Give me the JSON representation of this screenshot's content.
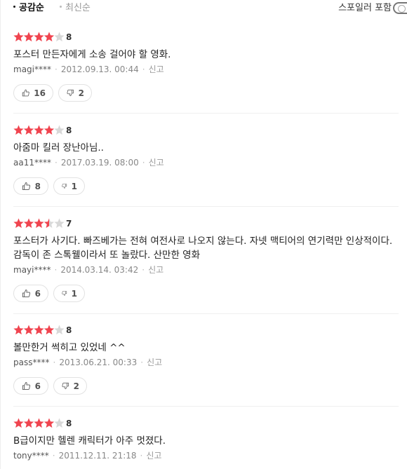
{
  "sort": {
    "option_sympathy": "공감순",
    "option_latest": "최신순",
    "spoiler_label": "스포일러 포함"
  },
  "colors": {
    "star_on": "#f0444f",
    "star_off": "#d8d8d8",
    "accent_text": "#111111"
  },
  "reviews": [
    {
      "stars": 4,
      "score": "8",
      "content": "포스터 만든자에게 소송 걸어야 할 영화.",
      "author": "magi****",
      "date": "2012.09.13. 00:44",
      "report": "신고",
      "likes": "16",
      "dislikes": "2"
    },
    {
      "stars": 4,
      "score": "8",
      "content": "아줌마 킬러 장난아님..",
      "author": "aa11****",
      "date": "2017.03.19. 08:00",
      "report": "신고",
      "likes": "8",
      "dislikes": "1"
    },
    {
      "stars": 3.5,
      "score": "7",
      "content": "포스터가 사기다. 빠즈베가는 전혀 여전사로 나오지 않는다. 자넷 맥티어의 연기력만 인상적이다.감독이 존 스톡웰이라서 또 놀랐다. 산만한 영화",
      "author": "mayi****",
      "date": "2014.03.14. 03:42",
      "report": "신고",
      "likes": "6",
      "dislikes": "1"
    },
    {
      "stars": 4,
      "score": "8",
      "content": "볼만한거 썩히고 있었네 ^^",
      "author": "pass****",
      "date": "2013.06.21. 00:33",
      "report": "신고",
      "likes": "6",
      "dislikes": "2"
    },
    {
      "stars": 4,
      "score": "8",
      "content": "B급이지만 헬렌 캐릭터가 아주 멋졌다.",
      "author": "tony****",
      "date": "2011.12.11. 21:18",
      "report": "신고",
      "likes": "",
      "dislikes": ""
    }
  ]
}
